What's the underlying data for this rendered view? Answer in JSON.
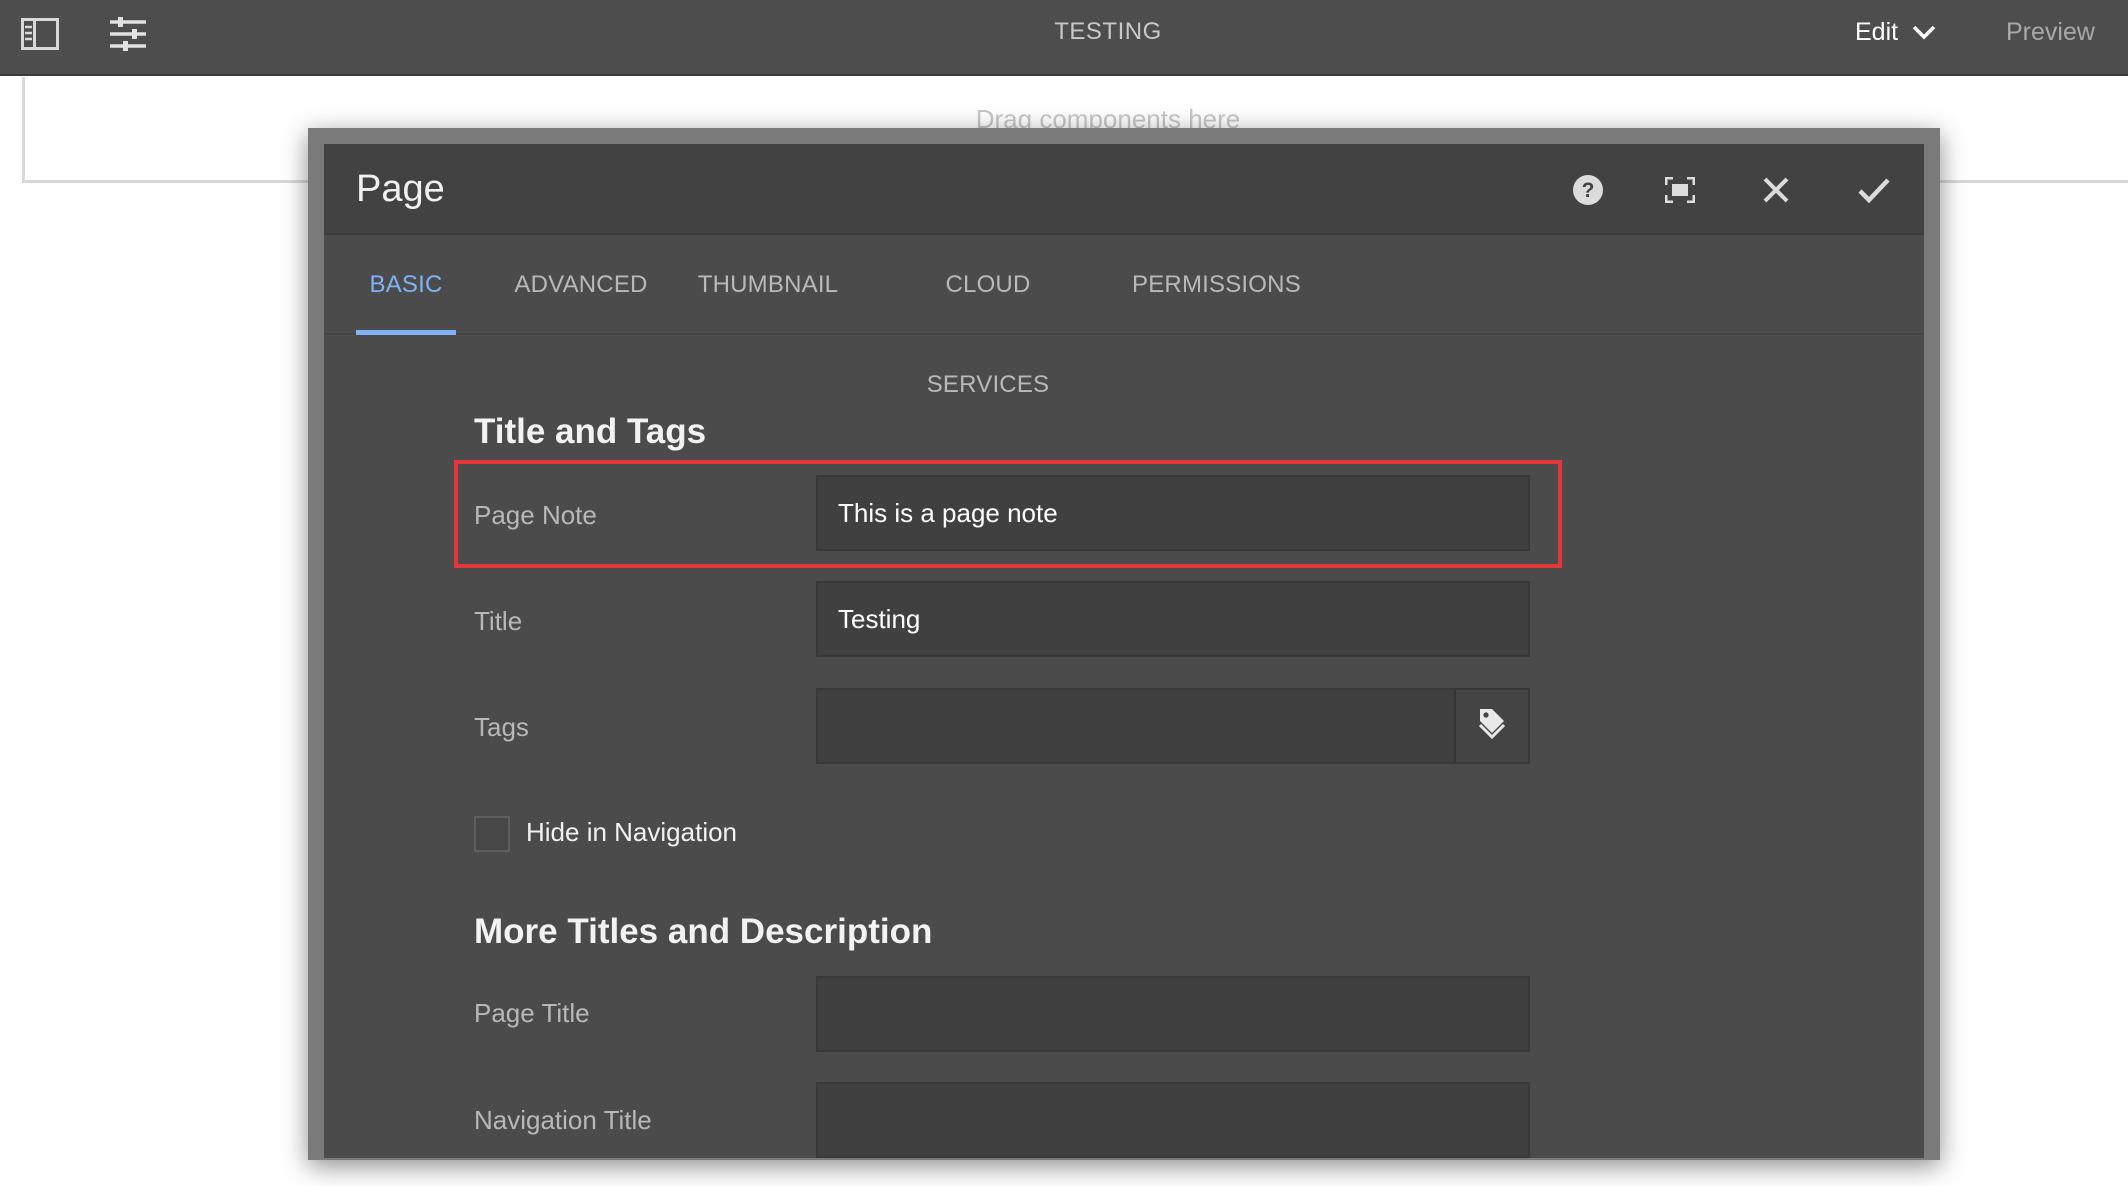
{
  "topbar": {
    "page_name": "TESTING",
    "edit_label": "Edit",
    "preview_label": "Preview",
    "icons": [
      "side-panel-icon",
      "page-properties-icon",
      "chevron-down-icon"
    ]
  },
  "canvas": {
    "drop_hint": "Drag components here"
  },
  "dialog": {
    "title": "Page",
    "header_icons": [
      "help-icon",
      "fullscreen-icon",
      "close-icon",
      "checkmark-icon"
    ],
    "tabs": [
      {
        "label": "BASIC"
      },
      {
        "label": "ADVANCED"
      },
      {
        "label": "THUMBNAIL"
      },
      {
        "label": "CLOUD SERVICES"
      },
      {
        "label": "PERMISSIONS"
      }
    ],
    "active_tab": "BASIC",
    "sections": {
      "title_tags": "Title and Tags",
      "more_titles": "More Titles and Description"
    },
    "fields": {
      "page_note": {
        "label": "Page Note",
        "value": "This is a page note"
      },
      "title": {
        "label": "Title",
        "value": "Testing"
      },
      "tags": {
        "label": "Tags",
        "value": ""
      },
      "hide_nav": {
        "label": "Hide in Navigation",
        "checked": false
      },
      "page_title": {
        "label": "Page Title",
        "value": ""
      },
      "nav_title": {
        "label": "Navigation Title",
        "value": ""
      }
    },
    "highlight_color": "#e3363a",
    "accent_color": "#7fb3f5"
  }
}
